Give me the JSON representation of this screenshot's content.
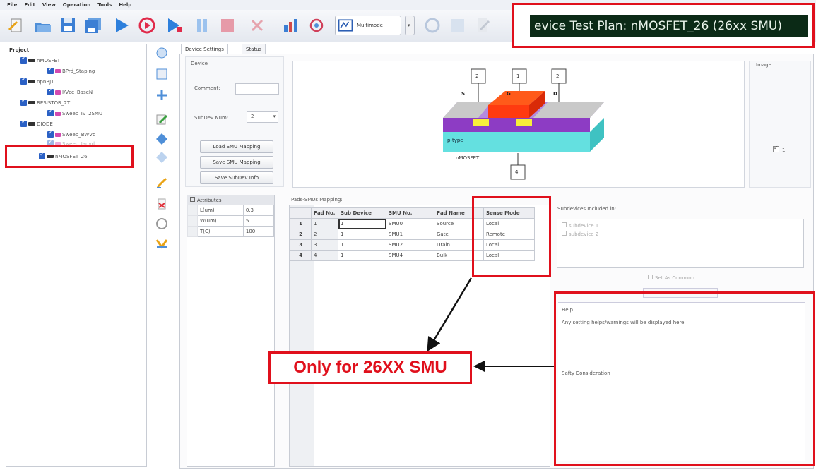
{
  "menu": [
    "File",
    "Edit",
    "View",
    "Operation",
    "Tools",
    "Help"
  ],
  "toolbar": {
    "multimode_label": "Multimode",
    "icons": [
      "new-icon",
      "open-icon",
      "save-icon",
      "save-all-icon",
      "run-icon",
      "run-continuous-icon",
      "run-step-icon",
      "pause-icon",
      "stop-icon",
      "delete-icon",
      "chart-icon",
      "refresh-icon",
      "multimode-icon",
      "config-icon",
      "export-icon",
      "edit-icon"
    ]
  },
  "title": "evice Test Plan: nMOSFET_26 (26xx SMU)",
  "tree": {
    "root": "Project",
    "items": [
      {
        "label": "nMOSFET",
        "level": 1
      },
      {
        "label": "BPrd_Staping",
        "level": 2
      },
      {
        "label": "npnBJT",
        "level": 1
      },
      {
        "label": "I/Vce_BaseN",
        "level": 2
      },
      {
        "label": "RESISTOR_2T",
        "level": 1
      },
      {
        "label": "Sweep_IV_2SMU",
        "level": 2
      },
      {
        "label": "DIODE",
        "level": 1
      },
      {
        "label": "Sweep_BWVd",
        "level": 2
      },
      {
        "label": "Sweep_Iadvd",
        "level": 2
      },
      {
        "label": "nMOSFET_26",
        "level": 1
      }
    ]
  },
  "tabs": [
    "Device Settings",
    "Status"
  ],
  "device": {
    "section": "Device",
    "comment_label": "Comment:",
    "subdev_label": "SubDev Num:",
    "subdev_value": "2",
    "buttons": [
      "Load SMU Mapping",
      "Save SMU Mapping",
      "Save SubDev Info"
    ],
    "image_label": "Image",
    "diagram": {
      "labels": [
        "2",
        "1",
        "2",
        "4"
      ],
      "terminals": [
        "S",
        "G",
        "D"
      ],
      "substrate": "p-type",
      "caption": "nMOSFET"
    },
    "image_check": "1"
  },
  "attributes": {
    "header": "Attributes",
    "rows": [
      [
        "L(um)",
        "0.3"
      ],
      [
        "W(um)",
        "5"
      ],
      [
        "T(C)",
        "100"
      ]
    ]
  },
  "mapping": {
    "title": "Pads-SMUs Mapping:",
    "columns": [
      "",
      "Pad No.",
      "Sub Device",
      "SMU No.",
      "Pad Name",
      "Sense Mode"
    ],
    "rows": [
      [
        "1",
        "1",
        "1",
        "SMU0",
        "Source",
        "Local"
      ],
      [
        "2",
        "2",
        "1",
        "SMU1",
        "Gate",
        "Remote"
      ],
      [
        "3",
        "3",
        "1",
        "SMU2",
        "Drain",
        "Local"
      ],
      [
        "4",
        "4",
        "1",
        "SMU4",
        "Bulk",
        "Local"
      ]
    ]
  },
  "subdevices": {
    "title": "Subdevices Included in:",
    "items": [
      "subdevice 1",
      "subdevice 2"
    ],
    "set_common": "Set As Common",
    "button": "Save As Set"
  },
  "help": {
    "title": "Help",
    "text": "Any setting helps/warnings will be displayed here.",
    "safety": "Safty Consideration"
  },
  "callout": "Only for 26XX SMU",
  "colors": {
    "highlight": "#e0101c",
    "title_bg": "#0b2a16"
  }
}
